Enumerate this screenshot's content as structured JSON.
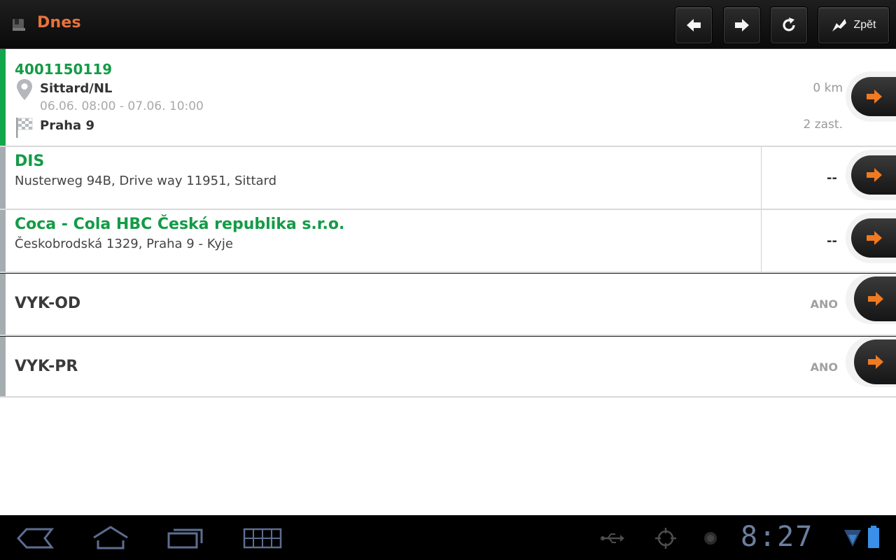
{
  "header": {
    "title": "Dnes",
    "back_label": "Zpět"
  },
  "route": {
    "order_number": "4001150119",
    "origin": "Sittard/NL",
    "time_window": "06.06. 08:00 - 07.06. 10:00",
    "destination": "Praha 9",
    "distance": "0 km",
    "stops": "2 zast."
  },
  "stops": [
    {
      "name": "DIS",
      "address": "Nusterweg 94B, Drive way 11951, Sittard",
      "value": "--"
    },
    {
      "name": "Coca - Cola HBC Česká republika s.r.o.",
      "address": "Českobrodská 1329, Praha 9 - Kyje",
      "value": "--"
    }
  ],
  "codes": [
    {
      "code": "VYK-OD",
      "value": "ANO"
    },
    {
      "code": "VYK-PR",
      "value": "ANO"
    }
  ],
  "status_bar": {
    "time": "8:27"
  },
  "colors": {
    "accent_orange": "#e8733a",
    "accent_green": "#139b46",
    "stripe_grey": "#a6adb0"
  }
}
